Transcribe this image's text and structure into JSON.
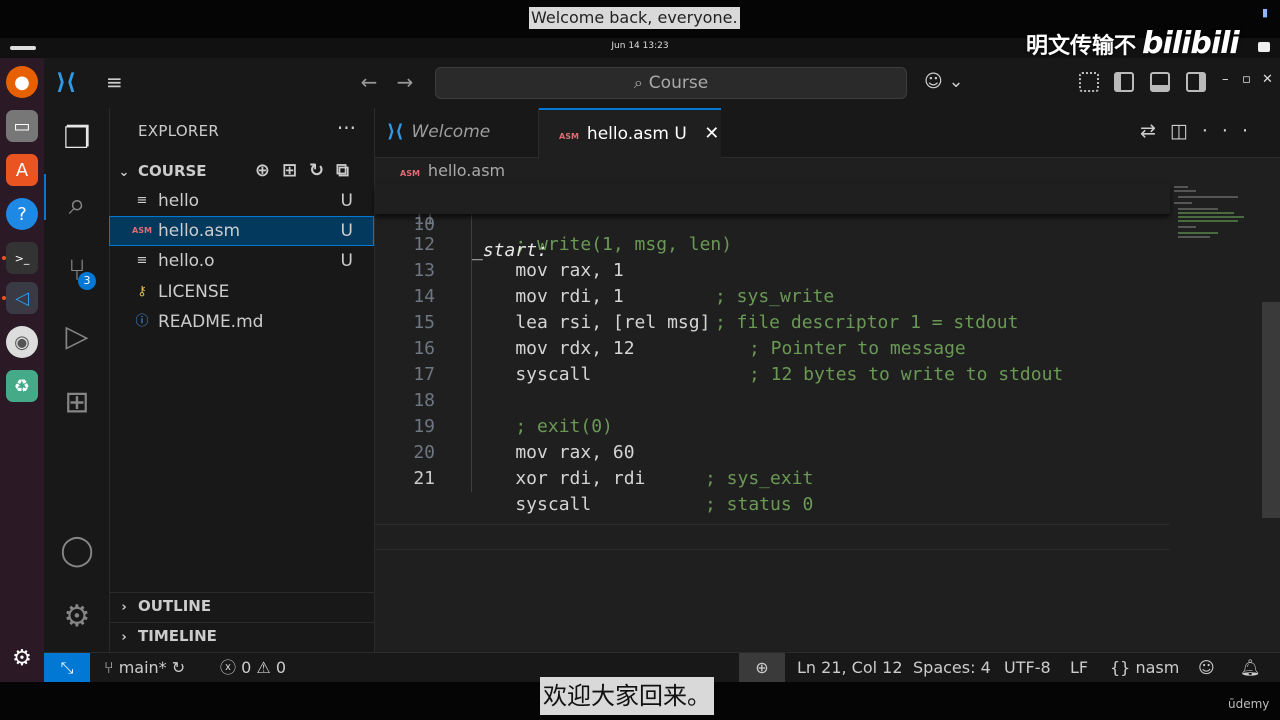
{
  "video": {
    "caption_top": "Welcome back, everyone.",
    "caption_bottom": "欢迎大家回来。",
    "watermark_text": "明文传输不",
    "watermark_logo": "bilibili",
    "udemy_label": "ūdemy"
  },
  "system": {
    "clock": "Jun 14  13:23"
  },
  "titlebar": {
    "search_text": "Course"
  },
  "activity": {
    "scm_badge": "3"
  },
  "sidebar": {
    "title": "EXPLORER",
    "more": "···",
    "folder": "COURSE",
    "files": [
      {
        "name": "hello",
        "status": "U",
        "icon": "≡"
      },
      {
        "name": "hello.asm",
        "status": "U",
        "icon": "ASM"
      },
      {
        "name": "hello.o",
        "status": "U",
        "icon": "≡"
      },
      {
        "name": "LICENSE",
        "status": "",
        "icon": "⚷"
      },
      {
        "name": "README.md",
        "status": "",
        "icon": "ⓘ"
      }
    ],
    "outline": "OUTLINE",
    "timeline": "TIMELINE"
  },
  "tabs": {
    "welcome": "Welcome",
    "active": "hello.asm",
    "active_status": "U",
    "asm_icon": "ASM"
  },
  "breadcrumb": {
    "file": "hello.asm",
    "icon": "ASM"
  },
  "editor": {
    "sticky": {
      "num": "10",
      "text": "_start:"
    },
    "lines": [
      {
        "num": "11",
        "code": "    ; write(1, msg, len)"
      },
      {
        "num": "12",
        "code": "    mov rax, 1",
        "comment": "; sys_write"
      },
      {
        "num": "13",
        "code": "    mov rdi, 1",
        "comment": "; file descriptor 1 = stdout"
      },
      {
        "num": "14",
        "code": "    lea rsi, [rel msg]",
        "comment": "; Pointer to message"
      },
      {
        "num": "15",
        "code": "    mov rdx, 12",
        "comment": "; 12 bytes to write to stdout"
      },
      {
        "num": "16",
        "code": "    syscall"
      },
      {
        "num": "17",
        "code": ""
      },
      {
        "num": "18",
        "code": "    ; exit(0)"
      },
      {
        "num": "19",
        "code": "    mov rax, 60",
        "comment": "; sys_exit"
      },
      {
        "num": "20",
        "code": "    xor rdi, rdi",
        "comment": "; status 0"
      },
      {
        "num": "21",
        "code": "    syscall"
      }
    ]
  },
  "status": {
    "branch": "main*",
    "errors": "0",
    "warnings": "0",
    "position": "Ln 21, Col 12",
    "spaces": "Spaces: 4",
    "encoding": "UTF-8",
    "eol": "LF",
    "language": "nasm"
  },
  "colors": {
    "accent": "#0078d4",
    "comment": "#6a9955",
    "asm_icon": "#e06c75"
  }
}
